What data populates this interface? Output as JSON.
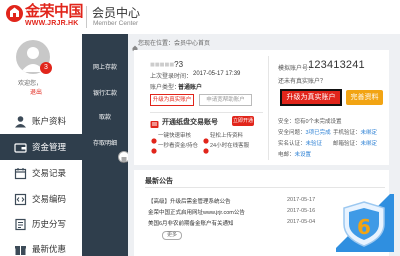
{
  "header": {
    "logo_name": "金荣中国",
    "logo_url": "WWW.JRJR.HK",
    "title": "会员中心",
    "subtitle": "Member Center"
  },
  "user": {
    "badge_count": "3",
    "welcome": "欢迎您，",
    "logout": "退出"
  },
  "sidebar": {
    "items": [
      {
        "label": "账户资料",
        "icon": "user-icon"
      },
      {
        "label": "资金管理",
        "icon": "wallet-icon"
      },
      {
        "label": "交易记录",
        "icon": "calendar-icon"
      },
      {
        "label": "交易编码",
        "icon": "code-icon"
      },
      {
        "label": "历史分写",
        "icon": "history-icon"
      },
      {
        "label": "最新优惠",
        "icon": "gift-icon"
      }
    ]
  },
  "subnav": {
    "items": [
      "网上存款",
      "银行汇款",
      "取款",
      "存取明细"
    ]
  },
  "breadcrumb": "您现在位置：会员中心首页",
  "account": {
    "name_suffix": "?3",
    "last_login_label": "上次登录时间：",
    "last_login_time": "2017-05-17 17:39",
    "type_label": "账户类型：",
    "type_value": "普通账户",
    "upgrade_small": "升级为真实账户",
    "apply_small": "申请宽帮助账户",
    "promo_title": "开通纸盘交易账号",
    "promo_button": "立即开通",
    "features": [
      "一键快速审核",
      "轻松上传资料",
      "一秒看资金/持仓",
      "24小时在线客服"
    ],
    "number_label": "模拟账户号：",
    "number": "123413241",
    "no_real_question": "还未有真实账户？",
    "upgrade_button": "升级为真实账户",
    "complete_button": "完善资料",
    "safety": "安全：您有0个未完成设置",
    "security": [
      {
        "label": "安全问题：",
        "value": "3项已完成"
      },
      {
        "label": "手机验证：",
        "value": "未绑定"
      },
      {
        "label": "实名认证：",
        "value": "未验证"
      },
      {
        "label": "邮箱验证：",
        "value": "未绑定"
      },
      {
        "label": "电邮：",
        "value": "未设置"
      }
    ]
  },
  "announcements": {
    "title": "最新公告",
    "items": [
      {
        "text": "【高级】升级后需金管理系统公告",
        "date": "2017-05-17"
      },
      {
        "text": "金荣中国正式启用网址www.jrjr.com公告",
        "date": "2017-05-16"
      },
      {
        "text": "美国6月非农前期备金账户有关通知",
        "date": "2017-05-04"
      }
    ],
    "more": "更多"
  },
  "colors": {
    "brand_red": "#e1251b",
    "dark_nav": "#2f3e4c",
    "accent_orange": "#f2a413",
    "link_blue": "#2a7fd4"
  }
}
